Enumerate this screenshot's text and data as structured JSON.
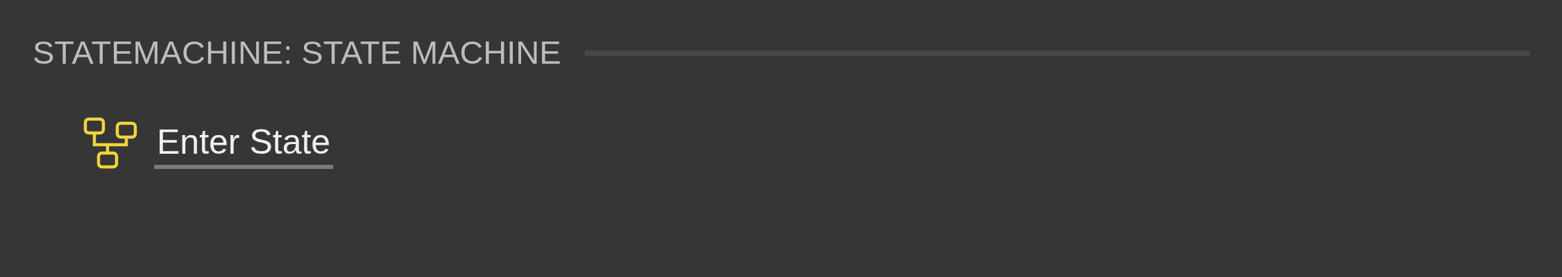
{
  "section": {
    "title": "STATEMACHINE: STATE MACHINE"
  },
  "items": [
    {
      "label": "Enter State"
    }
  ]
}
